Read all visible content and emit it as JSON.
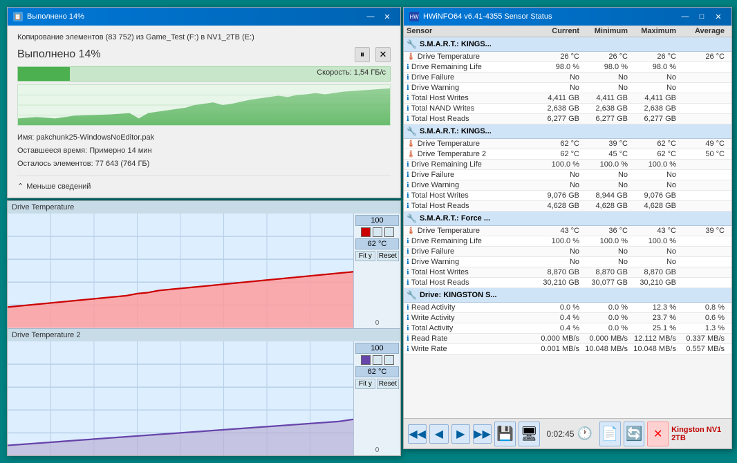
{
  "copy_dialog": {
    "title": "Выполнено 14%",
    "path_text": "Копирование элементов (83 752) из Game_Test (F:) в NV1_2TB (E:)",
    "progress_label": "Выполнено 14%",
    "speed": "Скорость: 1,54 ГБ/с",
    "filename_label": "Имя:",
    "filename": "pakchunk25-WindowsNoEditor.pak",
    "time_label": "Оставшееся время:",
    "time_value": "Примерно 14 мин",
    "items_label": "Осталось элементов:",
    "items_value": "77 643 (764 ГБ)",
    "less_details": "Меньше сведений",
    "pause_btn": "⏸",
    "close_btn": "✕",
    "minimize_btn": "—",
    "win_close_btn": "✕"
  },
  "hwinfo": {
    "title": "HWiNFO64 v6.41-4355 Sensor Status",
    "columns": [
      "Sensor",
      "Current",
      "Minimum",
      "Maximum",
      "Average"
    ],
    "minimize_btn": "—",
    "restore_btn": "□",
    "close_btn": "✕",
    "groups": [
      {
        "name": "S.M.A.R.T.: KINGS...",
        "rows": [
          {
            "name": "Drive Temperature",
            "icon": "temp",
            "current": "26 °C",
            "minimum": "26 °C",
            "maximum": "26 °C",
            "average": "26 °C"
          },
          {
            "name": "Drive Remaining Life",
            "icon": "info",
            "current": "98.0 %",
            "minimum": "98.0 %",
            "maximum": "98.0 %",
            "average": ""
          },
          {
            "name": "Drive Failure",
            "icon": "info",
            "current": "No",
            "minimum": "No",
            "maximum": "No",
            "average": ""
          },
          {
            "name": "Drive Warning",
            "icon": "info",
            "current": "No",
            "minimum": "No",
            "maximum": "No",
            "average": ""
          },
          {
            "name": "Total Host Writes",
            "icon": "info",
            "current": "4,411 GB",
            "minimum": "4,411 GB",
            "maximum": "4,411 GB",
            "average": ""
          },
          {
            "name": "Total NAND Writes",
            "icon": "info",
            "current": "2,638 GB",
            "minimum": "2,638 GB",
            "maximum": "2,638 GB",
            "average": ""
          },
          {
            "name": "Total Host Reads",
            "icon": "info",
            "current": "6,277 GB",
            "minimum": "6,277 GB",
            "maximum": "6,277 GB",
            "average": ""
          }
        ]
      },
      {
        "name": "S.M.A.R.T.: KINGS...",
        "rows": [
          {
            "name": "Drive Temperature",
            "icon": "temp",
            "current": "62 °C",
            "minimum": "39 °C",
            "maximum": "62 °C",
            "average": "49 °C"
          },
          {
            "name": "Drive Temperature 2",
            "icon": "temp",
            "current": "62 °C",
            "minimum": "45 °C",
            "maximum": "62 °C",
            "average": "50 °C"
          },
          {
            "name": "Drive Remaining Life",
            "icon": "info",
            "current": "100.0 %",
            "minimum": "100.0 %",
            "maximum": "100.0 %",
            "average": ""
          },
          {
            "name": "Drive Failure",
            "icon": "info",
            "current": "No",
            "minimum": "No",
            "maximum": "No",
            "average": ""
          },
          {
            "name": "Drive Warning",
            "icon": "info",
            "current": "No",
            "minimum": "No",
            "maximum": "No",
            "average": ""
          },
          {
            "name": "Total Host Writes",
            "icon": "info",
            "current": "9,076 GB",
            "minimum": "8,944 GB",
            "maximum": "9,076 GB",
            "average": ""
          },
          {
            "name": "Total Host Reads",
            "icon": "info",
            "current": "4,628 GB",
            "minimum": "4,628 GB",
            "maximum": "4,628 GB",
            "average": ""
          }
        ]
      },
      {
        "name": "S.M.A.R.T.: Force ...",
        "rows": [
          {
            "name": "Drive Temperature",
            "icon": "temp",
            "current": "43 °C",
            "minimum": "36 °C",
            "maximum": "43 °C",
            "average": "39 °C"
          },
          {
            "name": "Drive Remaining Life",
            "icon": "info",
            "current": "100.0 %",
            "minimum": "100.0 %",
            "maximum": "100.0 %",
            "average": ""
          },
          {
            "name": "Drive Failure",
            "icon": "info",
            "current": "No",
            "minimum": "No",
            "maximum": "No",
            "average": ""
          },
          {
            "name": "Drive Warning",
            "icon": "info",
            "current": "No",
            "minimum": "No",
            "maximum": "No",
            "average": ""
          },
          {
            "name": "Total Host Writes",
            "icon": "info",
            "current": "8,870 GB",
            "minimum": "8,870 GB",
            "maximum": "8,870 GB",
            "average": ""
          },
          {
            "name": "Total Host Reads",
            "icon": "info",
            "current": "30,210 GB",
            "minimum": "30,077 GB",
            "maximum": "30,210 GB",
            "average": ""
          }
        ]
      },
      {
        "name": "Drive: KINGSTON S...",
        "rows": [
          {
            "name": "Read Activity",
            "icon": "info",
            "current": "0.0 %",
            "minimum": "0.0 %",
            "maximum": "12.3 %",
            "average": "0.8 %"
          },
          {
            "name": "Write Activity",
            "icon": "info",
            "current": "0.4 %",
            "minimum": "0.0 %",
            "maximum": "23.7 %",
            "average": "0.6 %"
          },
          {
            "name": "Total Activity",
            "icon": "info",
            "current": "0.4 %",
            "minimum": "0.0 %",
            "maximum": "25.1 %",
            "average": "1.3 %"
          },
          {
            "name": "Read Rate",
            "icon": "info",
            "current": "0.000 MB/s",
            "minimum": "0.000 MB/s",
            "maximum": "12.112 MB/s",
            "average": "0.337 MB/s"
          },
          {
            "name": "Write Rate",
            "icon": "info",
            "current": "0.001 MB/s",
            "minimum": "10.048 MB/s",
            "maximum": "10.048 MB/s",
            "average": "0.557 MB/s"
          }
        ]
      }
    ],
    "bottom_bar": {
      "nav_back": "◀◀",
      "nav_prev": "◀",
      "nav_next": "▶",
      "nav_fwd": "▶▶",
      "time": "0:02:45",
      "status_text": "Kingston NV1 2TB"
    }
  },
  "charts": {
    "chart1": {
      "title": "Drive Temperature",
      "max_label": "100",
      "current_label": "62 °C",
      "min_label": "0",
      "fit_btn": "Fit y",
      "reset_btn": "Reset"
    },
    "chart2": {
      "title": "Drive Temperature 2",
      "max_label": "100",
      "current_label": "62 °C",
      "min_label": "0",
      "fit_btn": "Fit y",
      "reset_btn": "Reset"
    }
  }
}
